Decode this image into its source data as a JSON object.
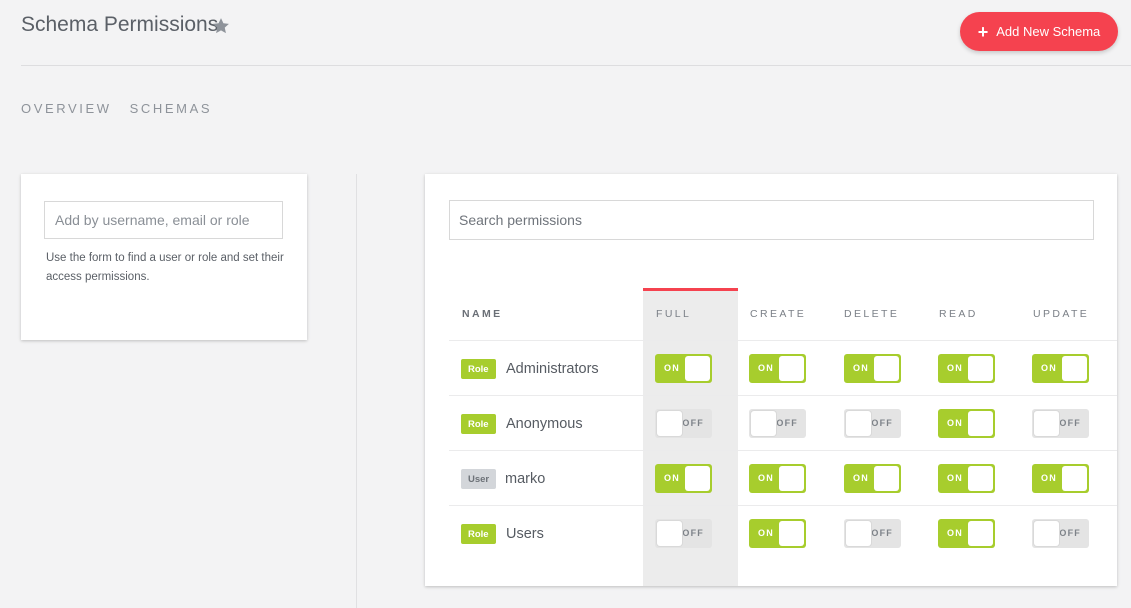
{
  "header": {
    "title": "Schema Permissions",
    "add_button_label": "Add New Schema"
  },
  "tabs": [
    {
      "label": "OVERVIEW"
    },
    {
      "label": "SCHEMAS"
    }
  ],
  "add_form": {
    "placeholder": "Add by username, email or role",
    "help_text": "Use the form to find a user or role and set their access permissions."
  },
  "permissions": {
    "search_placeholder": "Search permissions",
    "columns": [
      "NAME",
      "FULL",
      "CREATE",
      "DELETE",
      "READ",
      "UPDATE"
    ],
    "on_label": "ON",
    "off_label": "OFF",
    "rows": [
      {
        "type": "Role",
        "name": "Administrators",
        "full": true,
        "create": true,
        "delete": true,
        "read": true,
        "update": true
      },
      {
        "type": "Role",
        "name": "Anonymous",
        "full": false,
        "create": false,
        "delete": false,
        "read": true,
        "update": false
      },
      {
        "type": "User",
        "name": "marko",
        "full": true,
        "create": true,
        "delete": true,
        "read": true,
        "update": true
      },
      {
        "type": "Role",
        "name": "Users",
        "full": false,
        "create": true,
        "delete": false,
        "read": true,
        "update": false
      }
    ]
  },
  "colors": {
    "accent": "#f5424f",
    "toggle_on": "#a7cd2d",
    "toggle_off": "#e4e4e4"
  }
}
